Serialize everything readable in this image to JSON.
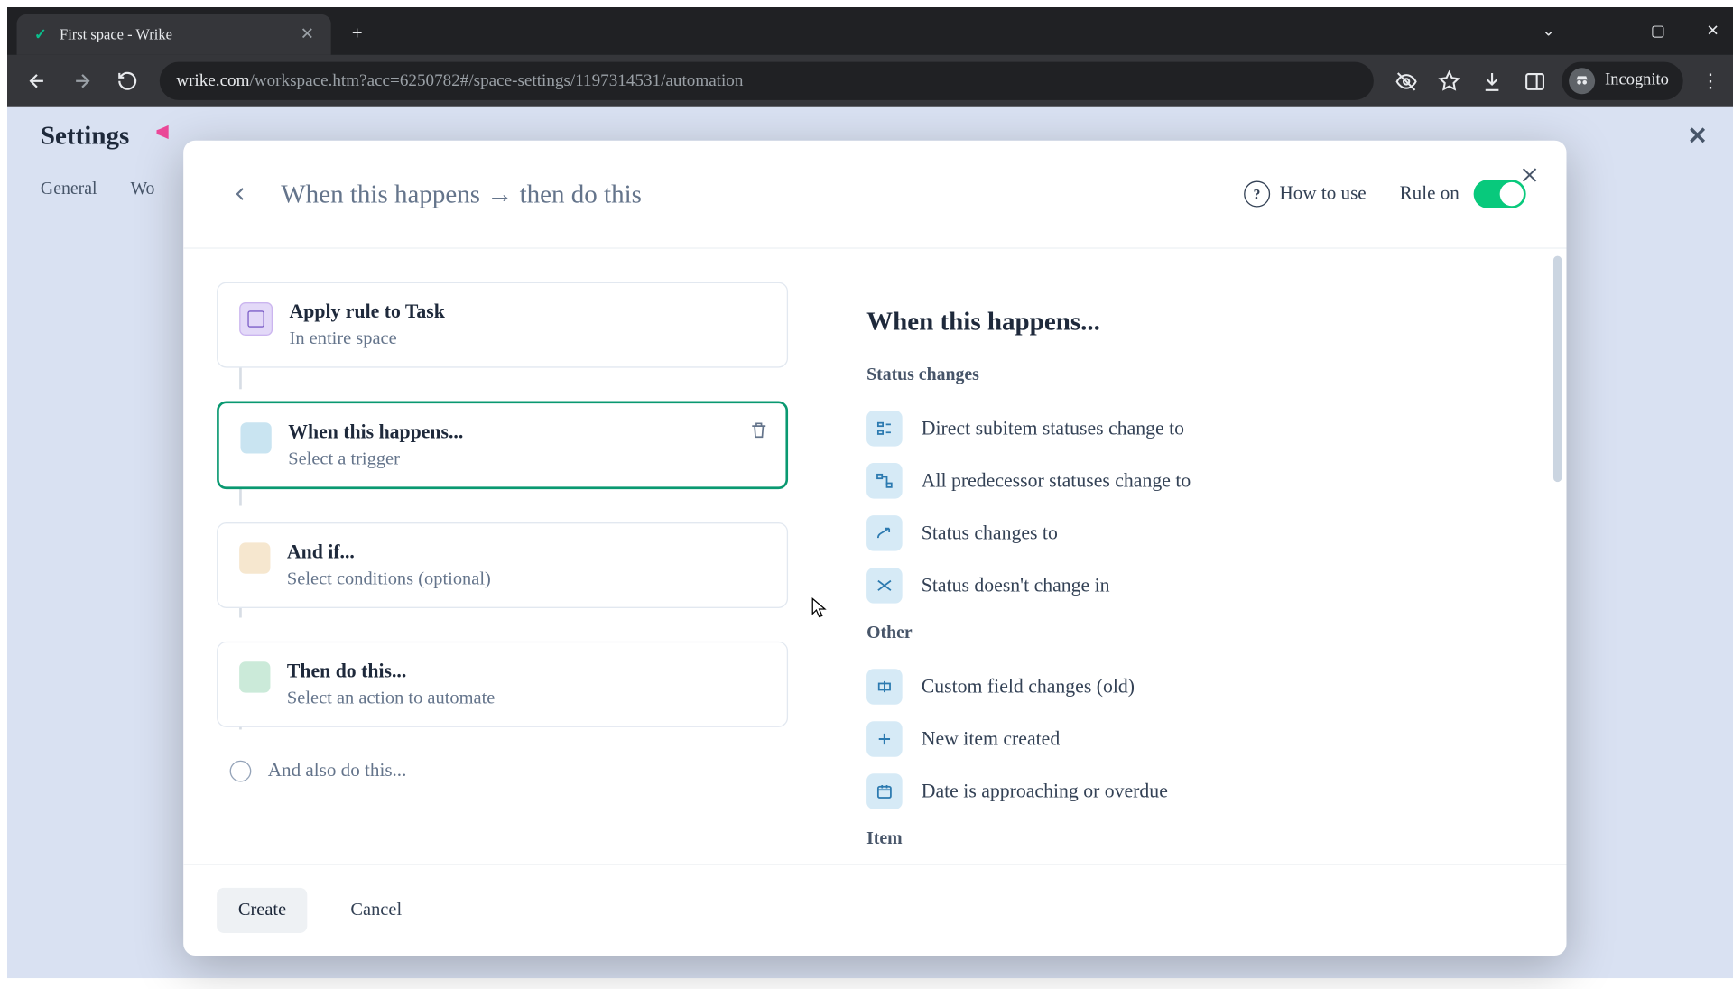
{
  "browser": {
    "tab_title": "First space - Wrike",
    "url_domain": "wrike.com",
    "url_path": "/workspace.htm?acc=6250782#/space-settings/1197314531/automation",
    "incognito_label": "Incognito"
  },
  "page": {
    "settings_title": "Settings",
    "tabs": {
      "general": "General",
      "workflows_partial": "Wo"
    }
  },
  "modal": {
    "title": "When this happens → then do this",
    "how_to_use": "How to use",
    "rule_on": "Rule on",
    "create": "Create",
    "cancel": "Cancel"
  },
  "builder": {
    "apply": {
      "title": "Apply rule to Task",
      "subtitle": "In entire space"
    },
    "trigger": {
      "title": "When this happens...",
      "subtitle": "Select a trigger"
    },
    "condition": {
      "title": "And if...",
      "subtitle": "Select conditions (optional)"
    },
    "action": {
      "title": "Then do this...",
      "subtitle": "Select an action to automate"
    },
    "also": "And also do this..."
  },
  "triggers": {
    "heading": "When this happens...",
    "groups": [
      {
        "label": "Status changes",
        "items": [
          "Direct subitem statuses change to",
          "All predecessor statuses change to",
          "Status changes to",
          "Status doesn't change in"
        ]
      },
      {
        "label": "Other",
        "items": [
          "Custom field changes (old)",
          "New item created",
          "Date is approaching or overdue"
        ]
      },
      {
        "label": "Item",
        "items": []
      }
    ]
  }
}
